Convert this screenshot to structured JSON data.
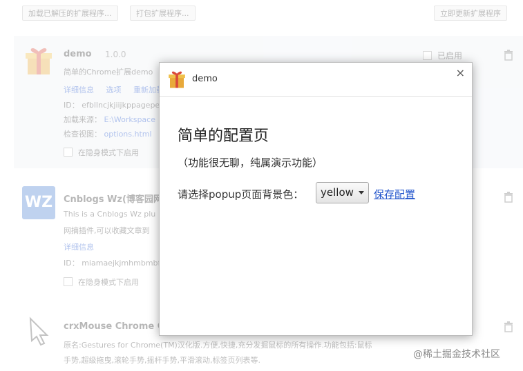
{
  "toolbar": {
    "load_unpacked": "加载已解压的扩展程序...",
    "pack_extension": "打包扩展程序...",
    "update_now": "立即更新扩展程序"
  },
  "extensions": [
    {
      "name": "demo",
      "version": "1.0.0",
      "enabled_label": "已启用",
      "description": "简单的Chrome扩展demo",
      "links": [
        "详细信息",
        "选项",
        "重新加载"
      ],
      "id_line": "ID： efbllncjkjiijkppagepel",
      "source_line_label": "加载来源：",
      "source_line_value": "E:\\Workspace",
      "inspect_label": "检查视图：",
      "inspect_value": "options.html",
      "incognito": "在隐身模式下启用"
    },
    {
      "name": "Cnblogs Wz(博客园网",
      "desc1": "This is a Cnblogs Wz plu",
      "desc2": "网摘插件,可以收藏文章到",
      "details": "详细信息",
      "id_line": "ID： miamaejkjmhmbmbf",
      "incognito": "在隐身模式下启用",
      "logo_text": "WZ"
    },
    {
      "name": "crxMouse Chrome Ge",
      "desc1": "原名:Gestures for Chrome(TM)汉化版.方便,快捷,充分发掘鼠标的所有操作.功能包括:鼠标",
      "desc2": "手势,超级拖曳,滚轮手势,摇杆手势,平滑滚动,标签页列表等."
    }
  ],
  "dialog": {
    "title": "demo",
    "close": "×",
    "heading": "简单的配置页",
    "subheading": "（功能很无聊，纯属演示功能）",
    "label": "请选择popup页面背景色：",
    "select_value": "yellow",
    "save": "保存配置"
  },
  "watermark": "@稀土掘金技术社区"
}
